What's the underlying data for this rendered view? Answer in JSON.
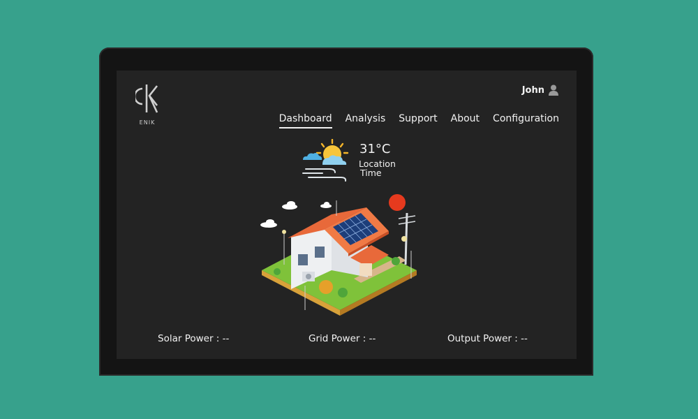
{
  "brand": {
    "logo_text": "ENIK"
  },
  "user": {
    "name": "John",
    "icon": "user-icon"
  },
  "nav": {
    "items": [
      {
        "label": "Dashboard",
        "active": true
      },
      {
        "label": "Analysis",
        "active": false
      },
      {
        "label": "Support",
        "active": false
      },
      {
        "label": "About",
        "active": false
      },
      {
        "label": "Configuration",
        "active": false
      }
    ]
  },
  "weather": {
    "temperature": "31°C",
    "location": "Location",
    "time": "Time",
    "icon": "partly-cloudy-windy-icon"
  },
  "illustration": {
    "icon": "solar-house-illustration"
  },
  "stats": {
    "solar": "Solar Power : --",
    "grid": "Grid Power : --",
    "output": "Output Power : --"
  },
  "colors": {
    "background": "#37a18c",
    "screen": "#232323",
    "bezel": "#141414",
    "text": "#f2f2f2",
    "sun": "#f5b52a",
    "roof": "#e8693a"
  }
}
